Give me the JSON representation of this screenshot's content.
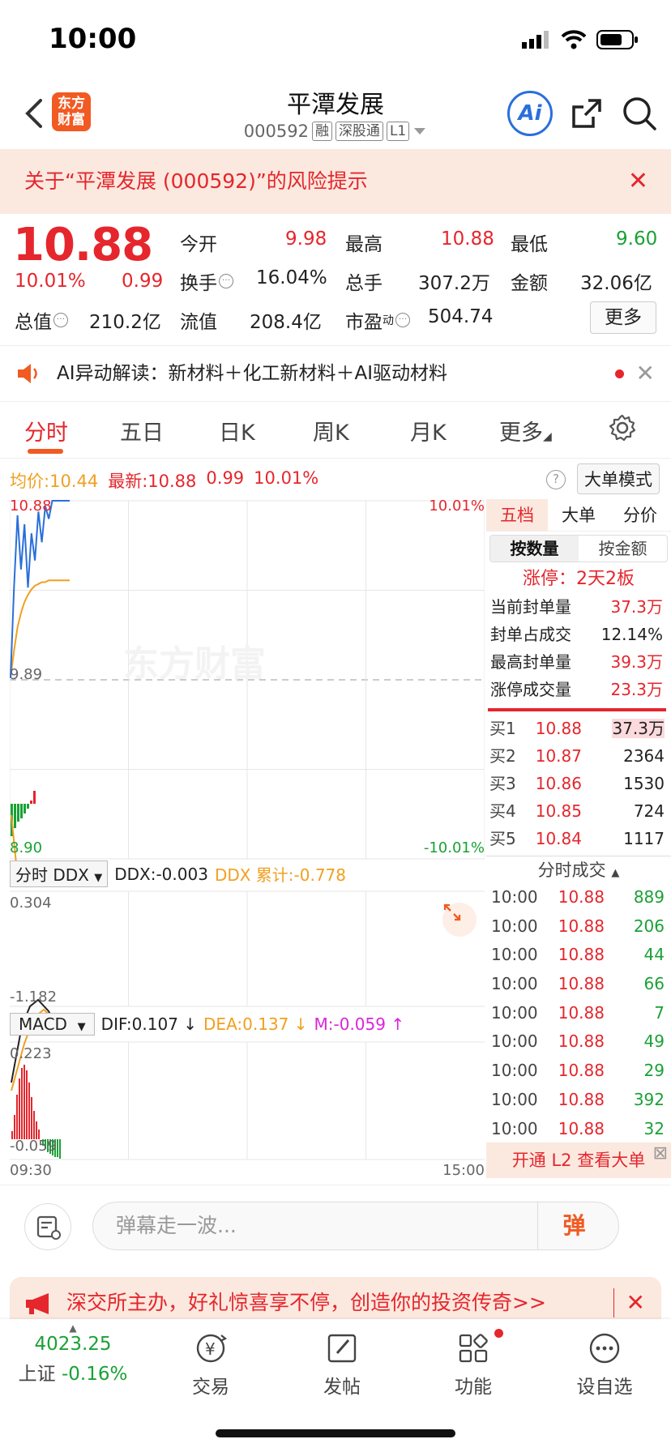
{
  "status_bar": {
    "time": "10:00"
  },
  "header": {
    "title": "平潭发展",
    "code": "000592",
    "tags": [
      "融",
      "深股通",
      "L1"
    ],
    "logo_text": [
      "东方",
      "财富"
    ],
    "ai_label": "Ai"
  },
  "risk_banner": {
    "text": "关于“平潭发展 (000592)”的风险提示"
  },
  "quote": {
    "price": "10.88",
    "change_pct": "10.01%",
    "change": "0.99",
    "fields": [
      {
        "label": "今开",
        "value": "9.98"
      },
      {
        "label": "最高",
        "value": "10.88"
      },
      {
        "label": "最低",
        "value": "9.60"
      },
      {
        "label": "换手",
        "value": "16.04%"
      },
      {
        "label": "总手",
        "value": "307.2万"
      },
      {
        "label": "金额",
        "value": "32.06亿"
      },
      {
        "label": "总值",
        "value": "210.2亿"
      },
      {
        "label": "流值",
        "value": "208.4亿"
      },
      {
        "label": "市盈",
        "sup": "动",
        "value": "504.74"
      }
    ],
    "more_label": "更多"
  },
  "ai_bar": {
    "text": "AI异动解读：新材料＋化工新材料＋AI驱动材料"
  },
  "tabs": [
    "分时",
    "五日",
    "日K",
    "周K",
    "月K",
    "更多"
  ],
  "avg_line": {
    "avg_label": "均价:",
    "avg_value": "10.44",
    "last_label": "最新:",
    "last_value": "10.88",
    "chg": "0.99",
    "pct": "10.01%"
  },
  "big_order_mode": "大单模式",
  "chart_data": {
    "type": "line",
    "title": "",
    "y_labels": {
      "top": "10.88",
      "mid": "9.89",
      "bottom": "8.90",
      "top_pct": "10.01%",
      "bottom_pct": "-10.01%"
    },
    "ylim": [
      8.9,
      10.88
    ],
    "prev_close": 9.89,
    "x_labels": [
      "09:30",
      "15:00"
    ],
    "price_series": [
      9.9,
      10.4,
      10.8,
      10.5,
      10.75,
      10.4,
      10.7,
      10.55,
      10.82,
      10.65,
      10.85,
      10.78,
      10.88,
      10.88,
      10.88,
      10.88,
      10.88,
      10.88
    ],
    "avg_series": [
      9.9,
      10.05,
      10.18,
      10.26,
      10.32,
      10.36,
      10.39,
      10.41,
      10.42,
      10.43,
      10.43,
      10.44,
      10.44,
      10.44,
      10.44,
      10.44,
      10.44,
      10.44
    ]
  },
  "ddx": {
    "selector": "分时 DDX",
    "ddx": "DDX:-0.003",
    "sum": "DDX 累计:-0.778",
    "top": "0.304",
    "bottom": "-1.182"
  },
  "macd": {
    "selector": "MACD",
    "dif": "DIF:0.107 ↓",
    "dea": "DEA:0.137 ↓",
    "m": "M:-0.059 ↑",
    "top": "0.223",
    "bottom": "-0.059"
  },
  "side": {
    "tabs": [
      "五档",
      "大单",
      "分价"
    ],
    "seg": [
      "按数量",
      "按金额"
    ],
    "limit_up": "涨停：2天2板",
    "stats": [
      {
        "label": "当前封单量",
        "value": "37.3万"
      },
      {
        "label": "封单占成交",
        "value": "12.14%"
      },
      {
        "label": "最高封单量",
        "value": "39.3万"
      },
      {
        "label": "涨停成交量",
        "value": "23.3万"
      }
    ],
    "bids": [
      {
        "name": "买1",
        "price": "10.88",
        "vol": "37.3万"
      },
      {
        "name": "买2",
        "price": "10.87",
        "vol": "2364"
      },
      {
        "name": "买3",
        "price": "10.86",
        "vol": "1530"
      },
      {
        "name": "买4",
        "price": "10.85",
        "vol": "724"
      },
      {
        "name": "买5",
        "price": "10.84",
        "vol": "1117"
      }
    ],
    "ticks_title": "分时成交",
    "ticks": [
      {
        "t": "10:00",
        "p": "10.88",
        "v": "889"
      },
      {
        "t": "10:00",
        "p": "10.88",
        "v": "206"
      },
      {
        "t": "10:00",
        "p": "10.88",
        "v": "44"
      },
      {
        "t": "10:00",
        "p": "10.88",
        "v": "66"
      },
      {
        "t": "10:00",
        "p": "10.88",
        "v": "7"
      },
      {
        "t": "10:00",
        "p": "10.88",
        "v": "49"
      },
      {
        "t": "10:00",
        "p": "10.88",
        "v": "29"
      },
      {
        "t": "10:00",
        "p": "10.88",
        "v": "392"
      },
      {
        "t": "10:00",
        "p": "10.88",
        "v": "32"
      }
    ],
    "l2": "开通 L2 查看大单"
  },
  "danmu": {
    "placeholder": "弹幕走一波...",
    "btn": "弹"
  },
  "promo": {
    "text": "深交所主办，好礼惊喜享不停，创造你的投资传奇>>"
  },
  "bottom_nav": {
    "index_value": "4023.25",
    "index_name": "上证",
    "index_chg": "-0.16%",
    "items": [
      "交易",
      "发帖",
      "功能",
      "设自选"
    ]
  },
  "watermark": "东方财富",
  "colors": {
    "up": "#e5262d",
    "down": "#1aa136",
    "price_line": "#2a6fdb",
    "avg_line": "#f0a020",
    "accent": "#f15a22"
  }
}
